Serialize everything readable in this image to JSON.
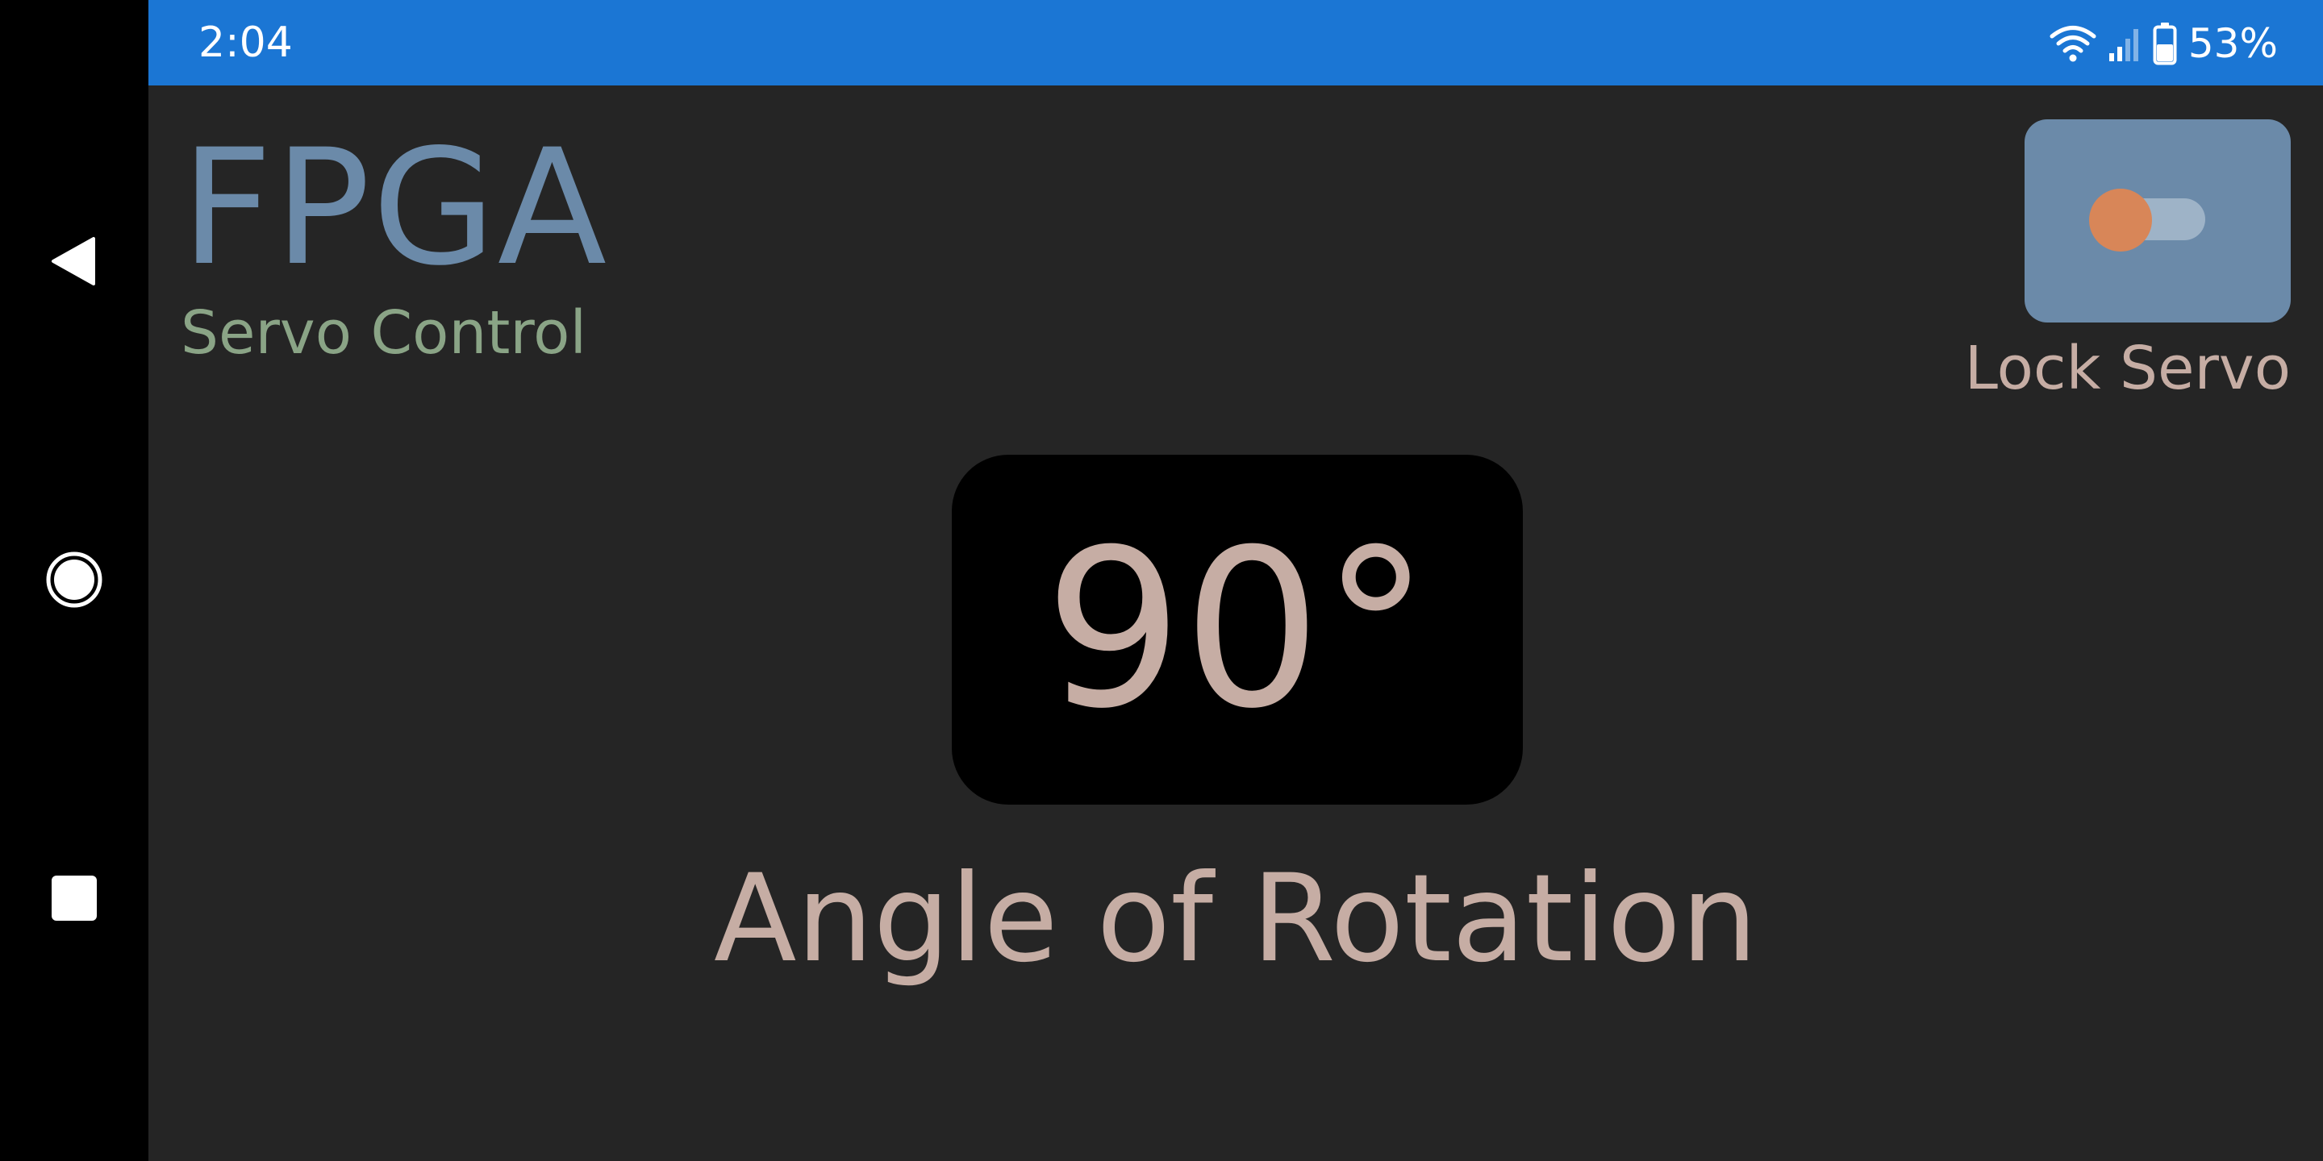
{
  "status_bar": {
    "time": "2:04",
    "battery_percent": "53%",
    "background_color": "#1b76d4",
    "icons": [
      "wifi-icon",
      "signal-icon",
      "battery-icon"
    ]
  },
  "navigation": {
    "back": "back-icon",
    "home": "home-icon",
    "recents": "recents-icon"
  },
  "header": {
    "title": "FPGA",
    "subtitle": "Servo Control"
  },
  "lock_servo": {
    "label": "Lock Servo",
    "toggle_on": false,
    "thumb_color": "#d88658",
    "card_color": "#6b8aa9"
  },
  "angle": {
    "value": "90°",
    "label": "Angle of Rotation",
    "text_color": "#c6ada4"
  }
}
